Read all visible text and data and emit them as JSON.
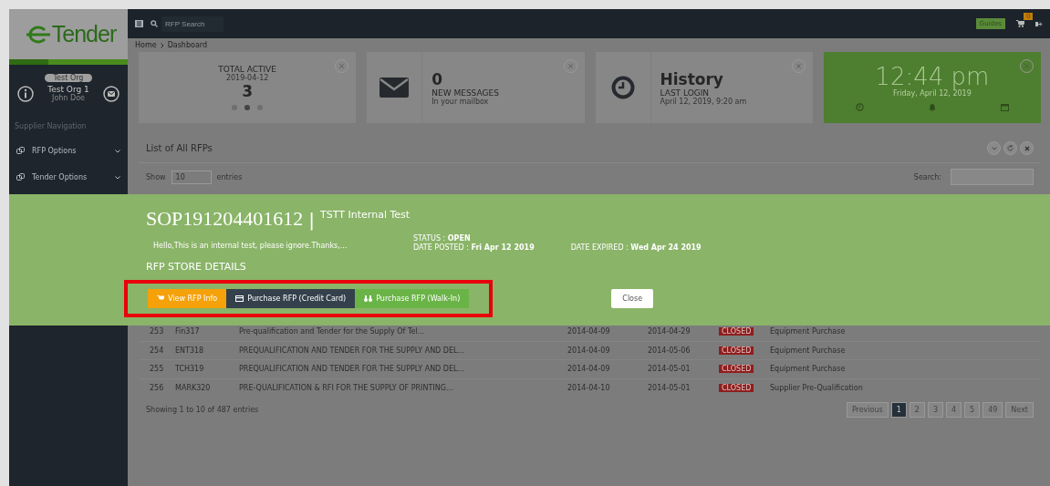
{
  "logo": {
    "text": "Tender"
  },
  "topbar": {
    "search_placeholder": "RFP Search",
    "guides": "Guides",
    "cart_count": "0"
  },
  "breadcrumb": [
    "Home",
    "Dashboard"
  ],
  "profile": {
    "badge": "Test Org",
    "name": "Test Org 1",
    "user": "John Doe"
  },
  "sidebar": {
    "heading": "Supplier Navigation",
    "items": [
      {
        "label": "RFP Options"
      },
      {
        "label": "Tender Options"
      }
    ]
  },
  "stats": [
    {
      "kind": "counter",
      "title": "TOTAL ACTIVE",
      "date": "2019-04-12",
      "value": "3",
      "dots": [
        {
          "selected": false
        },
        {
          "selected": true
        },
        {
          "selected": false
        }
      ]
    },
    {
      "kind": "messages",
      "value": "0",
      "title": "NEW MESSAGES",
      "subtitle": "In your mailbox"
    },
    {
      "kind": "login",
      "value": "History",
      "title": "LAST LOGIN",
      "subtitle": "April 12, 2019, 9:20 am"
    },
    {
      "kind": "clock",
      "time": "12:44 pm",
      "date": "Friday, April 12, 2019"
    }
  ],
  "panel": {
    "title": "List of All RFPs",
    "show_label": "Show",
    "entries_value": "10",
    "entries_label": "entries",
    "search_label": "Search:"
  },
  "table": {
    "rows": [
      {
        "number": "253",
        "code": "Fin317",
        "title": "Pre-qualification and Tender for the Supply Of Tel...",
        "posted": "2014-04-09",
        "expires": "2014-04-29",
        "status": "CLOSED",
        "category": "Equipment Purchase"
      },
      {
        "number": "254",
        "code": "ENT318",
        "title": "PREQUALIFICATION AND TENDER FOR THE SUPPLY AND DEL...",
        "posted": "2014-04-09",
        "expires": "2014-05-06",
        "status": "CLOSED",
        "category": "Equipment Purchase"
      },
      {
        "number": "255",
        "code": "TCH319",
        "title": "PREQUALIFICATION AND TENDER FOR THE SUPPLY AND DEL...",
        "posted": "2014-04-09",
        "expires": "2014-05-01",
        "status": "CLOSED",
        "category": "Equipment Purchase"
      },
      {
        "number": "256",
        "code": "MARK320",
        "title": "PRE-QUALIFICATION & RFI FOR THE SUPPLY OF PRINTING...",
        "posted": "2014-04-10",
        "expires": "2014-05-01",
        "status": "CLOSED",
        "category": "Supplier Pre-Qualification"
      }
    ],
    "info": "Showing 1 to 10 of 487 entries",
    "pagination": [
      {
        "label": "Previous",
        "selected": false
      },
      {
        "label": "1",
        "selected": true
      },
      {
        "label": "2",
        "selected": false
      },
      {
        "label": "3",
        "selected": false
      },
      {
        "label": "4",
        "selected": false
      },
      {
        "label": "5",
        "selected": false
      },
      {
        "label": "49",
        "selected": false
      },
      {
        "label": "Next",
        "selected": false
      }
    ]
  },
  "modal": {
    "code": "SOP191204401612",
    "separator": "|",
    "name": "TSTT Internal Test",
    "description": "Hello,This is an internal test, please ignore.Thanks,...",
    "status": "STATUS : **OPEN**",
    "posted": "DATE POSTED : **Fri Apr 12 2019**",
    "expired": "DATE EXPIRED : **Wed Apr 24 2019**",
    "section": "RFP STORE DETAILS",
    "buttons": [
      {
        "kind": "info",
        "label": "View RFP Info"
      },
      {
        "kind": "card",
        "label": "Purchase RFP (Credit Card)"
      },
      {
        "kind": "walkin",
        "label": "Purchase RFP (Walk-In)"
      }
    ],
    "highlighted": true,
    "close": "Close"
  }
}
